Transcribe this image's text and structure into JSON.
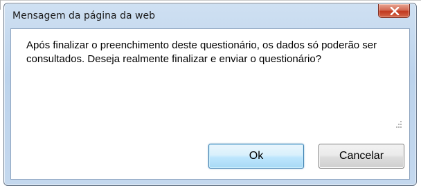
{
  "dialog": {
    "title": "Mensagem da página da web",
    "message": "Após finalizar o preenchimento deste questionário, os dados só poderão ser consultados. Deseja realmente finalizar e enviar o questionário?",
    "close_icon": "close-icon",
    "ok_label": "Ok",
    "cancel_label": "Cancelar"
  },
  "colors": {
    "frame": "#bcd3ec",
    "close_button": "#c2391f",
    "default_button_border": "#3c7fb1"
  }
}
